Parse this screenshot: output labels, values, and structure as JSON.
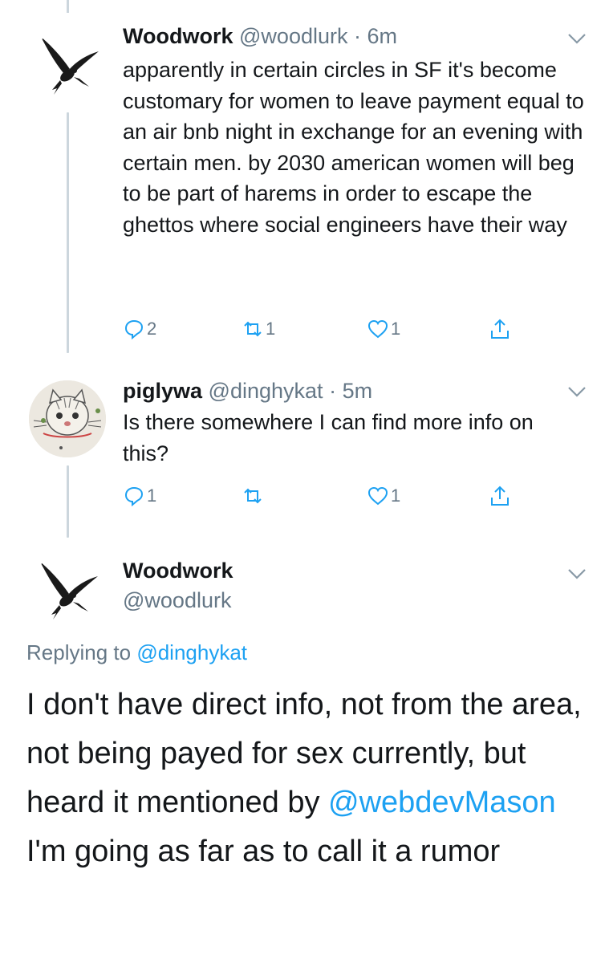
{
  "tweets": [
    {
      "name": "Woodwork",
      "handle": "@woodlurk",
      "dot": "·",
      "time": "6m",
      "text": "apparently in certain circles in SF it's become customary for women to leave payment equal to an air bnb night in exchange for an evening with certain men. by 2030 american women will beg to be part of harems in order to escape the ghettos where social engineers have their way",
      "replies": "2",
      "retweets": "1",
      "likes": "1",
      "avatar_icon": "bird-avatar-icon"
    },
    {
      "name": "piglywa",
      "handle": "@dinghykat",
      "dot": "·",
      "time": "5m",
      "text": "Is there somewhere I can find more info on this?",
      "replies": "1",
      "retweets": "",
      "likes": "1",
      "avatar_icon": "cat-drawing-avatar-icon"
    }
  ],
  "focused_tweet": {
    "name": "Woodwork",
    "handle": "@woodlurk",
    "replying_prefix": "Replying to",
    "replying_to": "@dinghykat",
    "text_part1": "I don't have direct info, not from the area, not being payed for sex currently, but heard it mentioned by",
    "mention": "@webdevMason",
    "text_part2": " I'm going as far as to call it a rumor",
    "avatar_icon": "bird-avatar-icon"
  },
  "colors": {
    "link": "#1da1f2",
    "secondary_text": "#657786",
    "primary_text": "#14171a",
    "thread_line": "#ccd6dd"
  }
}
